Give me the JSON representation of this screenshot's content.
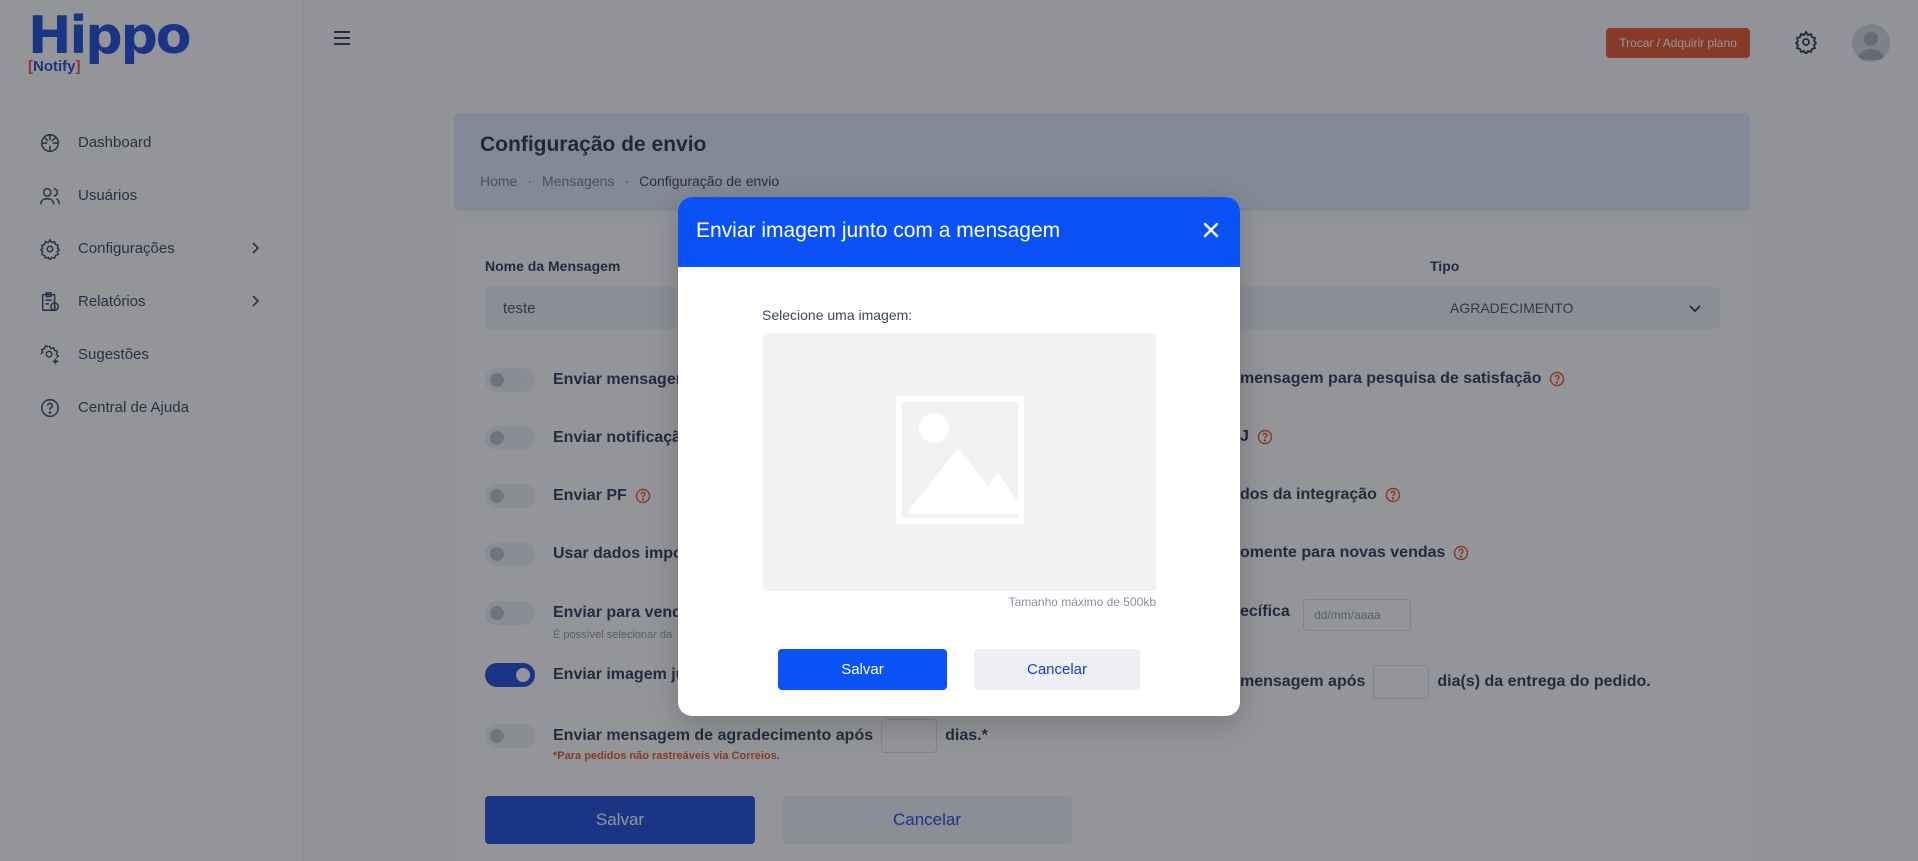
{
  "logo": {
    "main": "Hippo",
    "sub_left": "[",
    "sub_text": "Notify",
    "sub_right": "]"
  },
  "sidebar": {
    "items": [
      {
        "label": "Dashboard",
        "icon": "dashboard-icon"
      },
      {
        "label": "Usuários",
        "icon": "users-icon"
      },
      {
        "label": "Configurações",
        "icon": "gear-icon",
        "expandable": true
      },
      {
        "label": "Relatórios",
        "icon": "report-icon",
        "expandable": true
      },
      {
        "label": "Sugestões",
        "icon": "suggestion-icon"
      },
      {
        "label": "Central de Ajuda",
        "icon": "help-icon"
      }
    ]
  },
  "header": {
    "plan_button": "Trocar / Adquirir plano"
  },
  "page": {
    "title": "Configuração de envio",
    "breadcrumbs": [
      "Home",
      "Mensagens",
      "Configuração de envio"
    ]
  },
  "form": {
    "name_label": "Nome da Mensagem",
    "name_value": "teste",
    "type_label": "Tipo",
    "type_value": "AGRADECIMENTO",
    "left_options": [
      "Enviar mensagem",
      "Enviar notificação",
      "Enviar PF",
      "Usar dados impor",
      "Enviar para venda",
      "Enviar imagem ju",
      "Enviar mensagem de agradecimento após"
    ],
    "left_hint": "É possível selecionar da",
    "thanks_suffix": "dias.*",
    "thanks_warning": "*Para pedidos não rastreáveis via Correios.",
    "right_options": [
      "mensagem para pesquisa de satisfação",
      "J",
      "dos da integração",
      "omente para novas vendas",
      "ecífica",
      "mensagem após",
      "dia(s) da entrega do pedido."
    ],
    "date_placeholder": "dd/mm/aaaa",
    "toggle_states": [
      false,
      false,
      false,
      false,
      false,
      true,
      false
    ],
    "save_label": "Salvar",
    "cancel_label": "Cancelar"
  },
  "modal": {
    "title": "Enviar imagem junto com a mensagem",
    "select_label": "Selecione uma imagem:",
    "max_size_note": "Tamanho máximo de 500kb",
    "save_label": "Salvar",
    "cancel_label": "Cancelar"
  },
  "colors": {
    "brand": "#0f3fd6",
    "modal_header": "#0a52f5",
    "accent": "#e8491d"
  }
}
